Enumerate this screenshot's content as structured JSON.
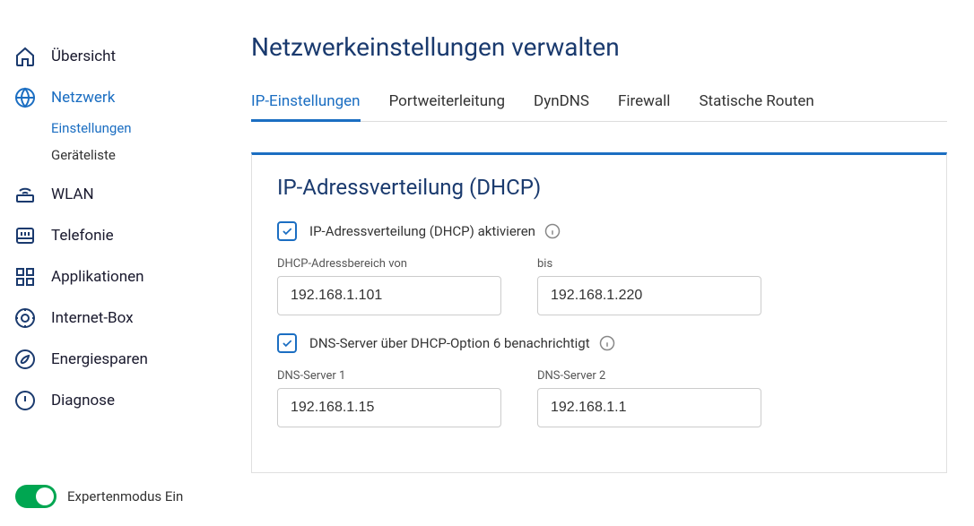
{
  "sidebar": {
    "items": [
      {
        "label": "Übersicht"
      },
      {
        "label": "Netzwerk",
        "active": true,
        "sub": [
          {
            "label": "Einstellungen",
            "active": true
          },
          {
            "label": "Geräteliste"
          }
        ]
      },
      {
        "label": "WLAN"
      },
      {
        "label": "Telefonie"
      },
      {
        "label": "Applikationen"
      },
      {
        "label": "Internet-Box"
      },
      {
        "label": "Energiesparen"
      },
      {
        "label": "Diagnose"
      }
    ],
    "expert_label": "Expertenmodus Ein"
  },
  "page": {
    "title": "Netzwerkeinstellungen verwalten",
    "tabs": [
      {
        "label": "IP-Einstellungen",
        "active": true
      },
      {
        "label": "Portweiterleitung"
      },
      {
        "label": "DynDNS"
      },
      {
        "label": "Firewall"
      },
      {
        "label": "Statische Routen"
      }
    ]
  },
  "panel": {
    "title": "IP-Adressverteilung (DHCP)",
    "check1_label": "IP-Adressverteilung (DHCP) aktivieren",
    "from_label": "DHCP-Adressbereich von",
    "from_value": "192.168.1.101",
    "to_label": "bis",
    "to_value": "192.168.1.220",
    "check2_label": "DNS-Server über DHCP-Option 6 benachrichtigt",
    "dns1_label": "DNS-Server 1",
    "dns1_value": "192.168.1.15",
    "dns2_label": "DNS-Server 2",
    "dns2_value": "192.168.1.1"
  }
}
